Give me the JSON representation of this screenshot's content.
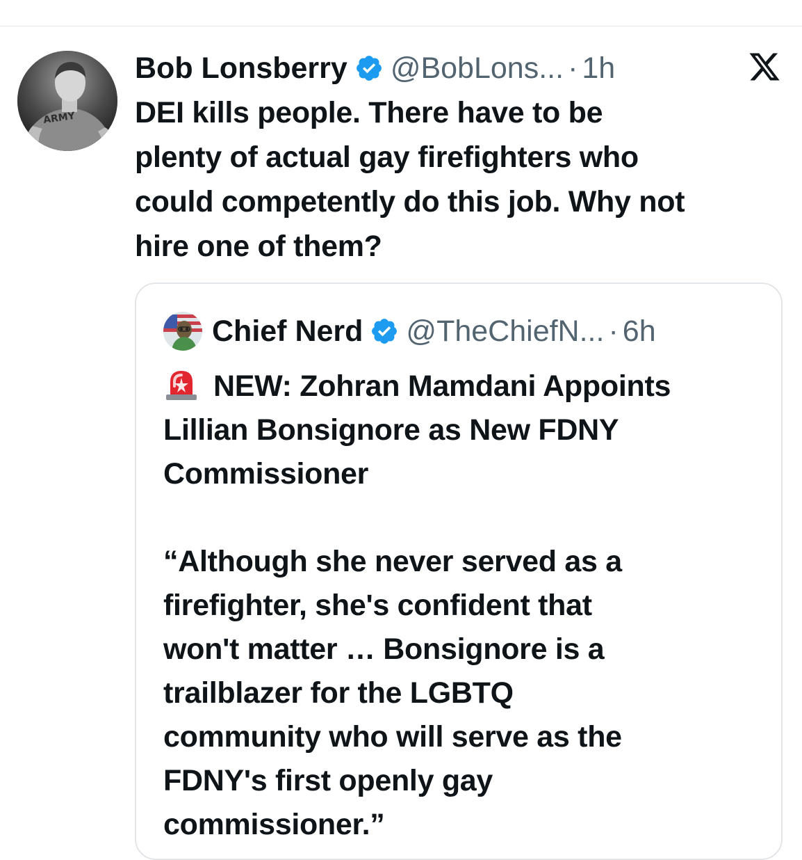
{
  "tweet": {
    "author_name": "Bob Lonsberry",
    "handle": "@BobLons...",
    "separator": "·",
    "time": "1h",
    "avatar_icon": "profile-photo-army-shirt",
    "text_lines": [
      "DEI kills people. There have to be",
      "plenty of actual gay firefighters who",
      "could competently do this job. Why not",
      "hire one of them?"
    ]
  },
  "quoted_tweet": {
    "author_name": "Chief Nerd",
    "handle": "@TheChiefN...",
    "separator": "·",
    "time": "6h",
    "emoji": "🚨",
    "headline_lines": [
      "NEW: Zohran Mamdani Appoints",
      "Lillian Bonsignore as New FDNY",
      "Commissioner"
    ],
    "quote_lines": [
      "“Although she never served as a",
      "firefighter, she's confident that",
      "won't matter … Bonsignore is a",
      "trailblazer for the LGBTQ",
      "community who will serve as the",
      "FDNY's first openly gay",
      "commissioner.”"
    ]
  },
  "icons": {
    "verified": "verified-badge-icon",
    "brand": "x-logo-icon",
    "siren": "siren-icon"
  },
  "colors": {
    "text_primary": "#0f1419",
    "text_secondary": "#536471",
    "verified_blue": "#1d9bf0",
    "border": "#e3e6e9"
  }
}
